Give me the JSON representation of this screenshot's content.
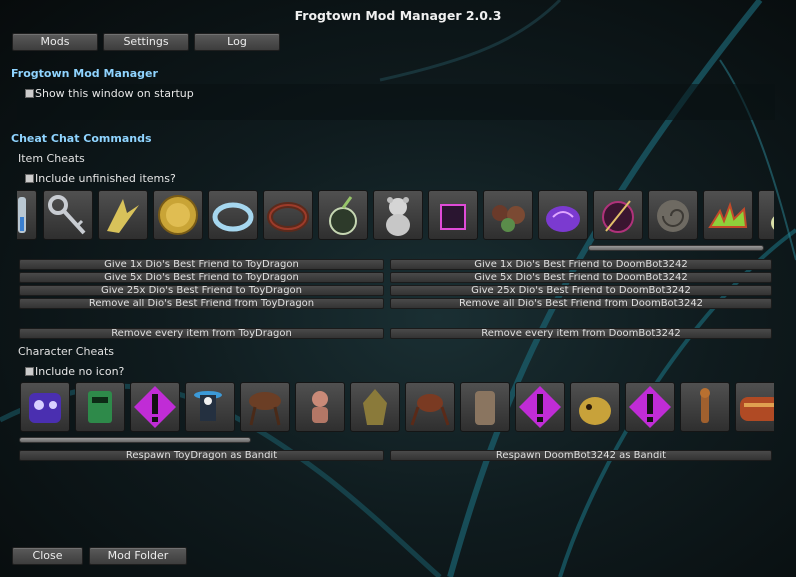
{
  "window": {
    "title": "Frogtown Mod Manager 2.0.3"
  },
  "tabs": [
    {
      "label": "Mods"
    },
    {
      "label": "Settings"
    },
    {
      "label": "Log"
    }
  ],
  "general": {
    "header": "Frogtown Mod Manager",
    "startup_toggle": "Show this window on startup"
  },
  "cheats": {
    "header": "Cheat Chat Commands",
    "items": {
      "subheader": "Item Cheats",
      "toggle": "Include unfinished items?",
      "icons": [
        "syringe-icon",
        "key-icon",
        "tooth-icon",
        "gold-coin-icon",
        "ring-icon",
        "bracelet-icon",
        "bomb-icon",
        "teddy-bear-icon",
        "dark-cube-icon",
        "fungus-icon",
        "brain-icon",
        "orb-icon",
        "fossil-icon",
        "antler-icon",
        "duck-icon"
      ],
      "left_actions": [
        "Give 1x Dio's Best Friend to ToyDragon",
        "Give 5x Dio's Best Friend to ToyDragon",
        "Give 25x Dio's Best Friend to ToyDragon",
        "Remove all Dio's Best Friend from ToyDragon"
      ],
      "right_actions": [
        "Give 1x Dio's Best Friend to DoomBot3242",
        "Give 5x Dio's Best Friend to DoomBot3242",
        "Give 25x Dio's Best Friend to DoomBot3242",
        "Remove all Dio's Best Friend from DoomBot3242"
      ],
      "remove_left": "Remove every item from ToyDragon",
      "remove_right": "Remove every item from DoomBot3242"
    },
    "characters": {
      "subheader": "Character Cheats",
      "toggle": "Include no icon?",
      "icons": [
        "purple-robot-icon",
        "green-robot-icon",
        "missing-icon",
        "bandit-icon",
        "beetle-icon",
        "imp-icon",
        "golem-icon",
        "spider-icon",
        "stone-golem-icon",
        "missing-icon",
        "wisp-beast-icon",
        "missing-icon",
        "lemurian-icon",
        "bug-machine-icon"
      ],
      "respawn_left": "Respawn ToyDragon as Bandit",
      "respawn_right": "Respawn DoomBot3242 as Bandit"
    }
  },
  "footer": {
    "close_label": "Close",
    "mod_folder_label": "Mod Folder"
  },
  "colors": {
    "accent": "#8fd4ff",
    "missing_icon": "#c02cd6"
  }
}
